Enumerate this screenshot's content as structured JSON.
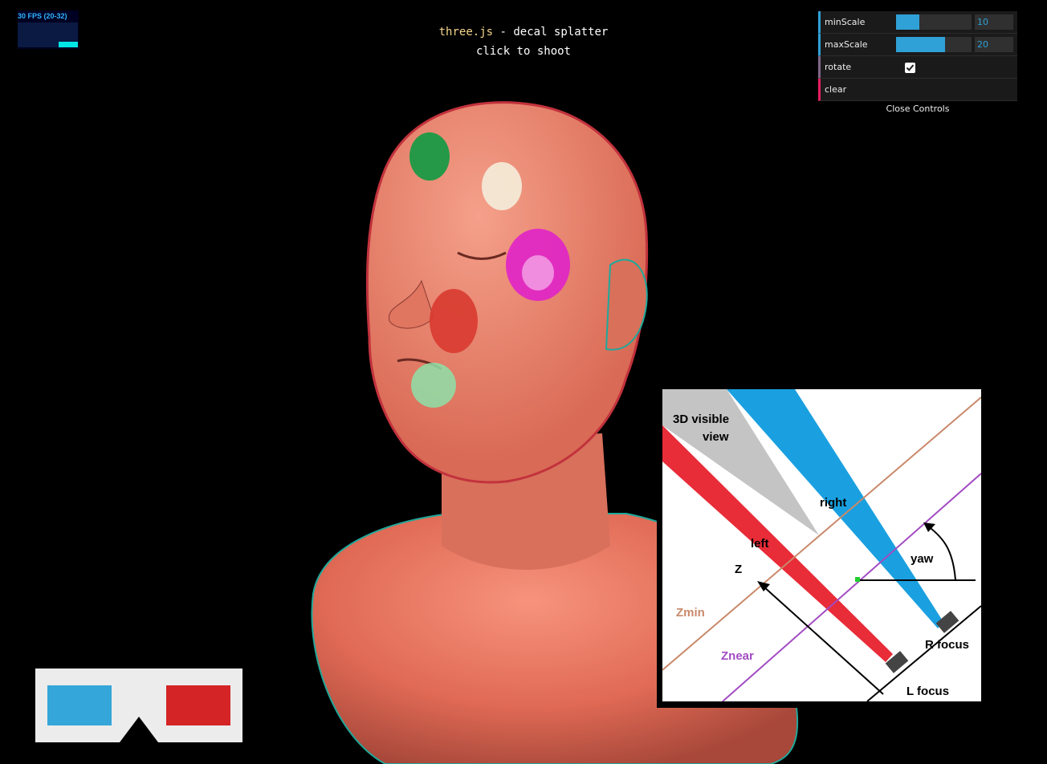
{
  "stats": {
    "fps_text": "30 FPS (20-32)"
  },
  "info": {
    "link": "three.js",
    "title_rest": " - decal splatter",
    "subtitle": "click to shoot"
  },
  "gui": {
    "controls": [
      {
        "label": "minScale",
        "value": "10",
        "fill": 0.31
      },
      {
        "label": "maxScale",
        "value": "20",
        "fill": 0.65
      },
      {
        "label": "rotate",
        "checked": true
      },
      {
        "label": "clear"
      }
    ],
    "close_label": "Close Controls",
    "colors": {
      "number": "#2fa1d6",
      "boolean": "#806787",
      "function": "#e61d5f"
    }
  },
  "diagram": {
    "labels": {
      "visible": "3D visible",
      "visible2": "view",
      "right": "right",
      "left": "left",
      "yaw": "yaw",
      "z": "Z",
      "zmin": "Zmin",
      "znear": "Znear",
      "rfocus": "R focus",
      "lfocus": "L focus"
    },
    "colors": {
      "left": "#e82c38",
      "right": "#1aa0e0",
      "visible": "#c4c4c4",
      "zmin": "#c9896a",
      "znear": "#a24bc2"
    }
  },
  "glasses": {
    "left_lens": "#35a6d9",
    "right_lens": "#d42425",
    "frame": "#ececec"
  }
}
